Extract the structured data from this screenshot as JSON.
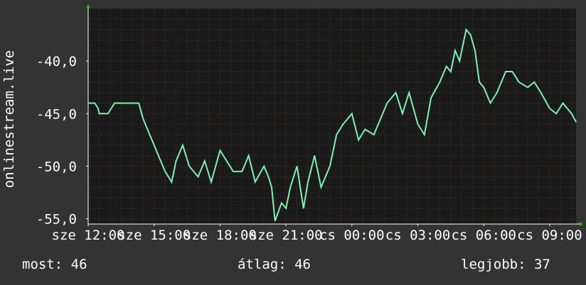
{
  "colors": {
    "background": "#333333",
    "plot_background": "#1a1a1a",
    "line": "#80f0b0",
    "grid_minor": "#3d3d3d",
    "grid_major": "#6b2a2a",
    "text": "#ffffff",
    "axis_arrow": "#00cc00"
  },
  "chart_data": {
    "type": "line",
    "ylabel": "onlinestream.live",
    "yticks": [
      "-40,0",
      "-45,0",
      "-50,0",
      "-55,0"
    ],
    "ytick_values": [
      -40,
      -45,
      -50,
      -55
    ],
    "ylim": [
      -55.5,
      -35
    ],
    "xticks": [
      "sze 12:00",
      "sze 15:00",
      "sze 18:00",
      "sze 21:00",
      "cs 00:00",
      "cs 03:00",
      "cs 06:00",
      "cs 09:00"
    ],
    "xtick_hours": [
      12,
      15,
      18,
      21,
      24,
      27,
      30,
      33
    ],
    "xlim": [
      12,
      34.2
    ],
    "grid": true,
    "series": [
      {
        "x": [
          12.0,
          12.3,
          12.45,
          12.5,
          12.9,
          13.2,
          13.3,
          13.7,
          14.0,
          14.3,
          14.5,
          15.0,
          15.5,
          15.8,
          16.0,
          16.3,
          16.6,
          17.0,
          17.3,
          17.6,
          18.0,
          18.3,
          18.6,
          19.0,
          19.3,
          19.6,
          20.0,
          20.2,
          20.35,
          20.5,
          20.8,
          21.0,
          21.2,
          21.5,
          21.8,
          22.0,
          22.3,
          22.6,
          23.0,
          23.3,
          23.6,
          24.0,
          24.3,
          24.6,
          25.0,
          25.3,
          25.6,
          26.0,
          26.3,
          26.6,
          27.0,
          27.3,
          27.6,
          28.0,
          28.3,
          28.5,
          28.7,
          28.9,
          29.1,
          29.2,
          29.4,
          29.6,
          29.8,
          30.0,
          30.3,
          30.6,
          31.0,
          31.3,
          31.6,
          32.0,
          32.3,
          32.6,
          33.0,
          33.3,
          33.6,
          34.0,
          34.2
        ],
        "y": [
          -44.0,
          -44.0,
          -44.5,
          -45.0,
          -45.0,
          -44.0,
          -44.0,
          -44.0,
          -44.0,
          -44.0,
          -45.5,
          -48.0,
          -50.5,
          -51.5,
          -49.5,
          -48.0,
          -50.0,
          -51.0,
          -49.5,
          -51.5,
          -48.5,
          -49.5,
          -50.5,
          -50.5,
          -49.0,
          -51.5,
          -50.0,
          -51.0,
          -52.0,
          -55.2,
          -53.5,
          -54.0,
          -52.0,
          -50.0,
          -54.0,
          -51.5,
          -49.0,
          -52.0,
          -50.0,
          -47.0,
          -46.0,
          -45.0,
          -47.5,
          -46.5,
          -47.0,
          -45.5,
          -44.0,
          -43.0,
          -45.0,
          -43.0,
          -46.0,
          -47.0,
          -43.5,
          -42.0,
          -40.5,
          -41.0,
          -39.0,
          -40.0,
          -38.0,
          -37.0,
          -37.5,
          -39.0,
          -42.0,
          -42.5,
          -44.0,
          -43.0,
          -41.0,
          -41.0,
          -42.0,
          -42.5,
          -42.0,
          -43.0,
          -44.5,
          -45.0,
          -44.0,
          -45.0,
          -45.8
        ]
      }
    ]
  },
  "stats": {
    "now_label": "most:",
    "now_value": "46",
    "avg_label": "átlag:",
    "avg_value": "46",
    "max_label": "legjobb:",
    "max_value": "37"
  }
}
